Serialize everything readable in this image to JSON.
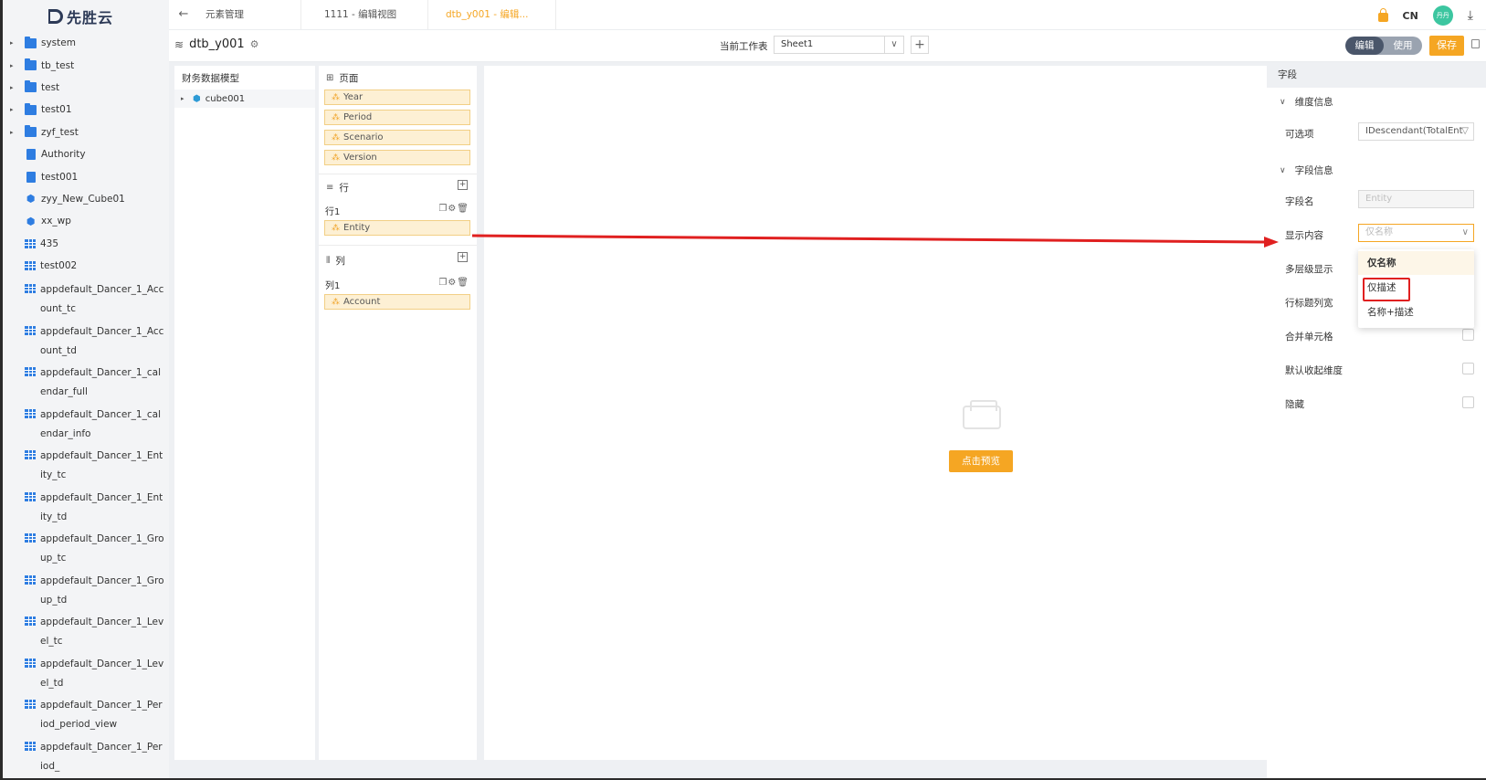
{
  "app": {
    "logo_text": "先胜云"
  },
  "sidebar": {
    "items": [
      {
        "label": "system",
        "type": "folder",
        "expandable": true
      },
      {
        "label": "tb_test",
        "type": "folder",
        "expandable": true
      },
      {
        "label": "test",
        "type": "folder",
        "expandable": true
      },
      {
        "label": "test01",
        "type": "folder",
        "expandable": true
      },
      {
        "label": "zyf_test",
        "type": "folder",
        "expandable": true
      },
      {
        "label": "Authority",
        "type": "doc"
      },
      {
        "label": "test001",
        "type": "doc"
      },
      {
        "label": "zyy_New_Cube01",
        "type": "cube"
      },
      {
        "label": "xx_wp",
        "type": "cube"
      },
      {
        "label": "435",
        "type": "table"
      },
      {
        "label": "test002",
        "type": "table"
      },
      {
        "label": "appdefault_Dancer_1_Account_tc",
        "type": "table"
      },
      {
        "label": "appdefault_Dancer_1_Account_td",
        "type": "table"
      },
      {
        "label": "appdefault_Dancer_1_calendar_full",
        "type": "table"
      },
      {
        "label": "appdefault_Dancer_1_calendar_info",
        "type": "table"
      },
      {
        "label": "appdefault_Dancer_1_Entity_tc",
        "type": "table"
      },
      {
        "label": "appdefault_Dancer_1_Entity_td",
        "type": "table"
      },
      {
        "label": "appdefault_Dancer_1_Group_tc",
        "type": "table"
      },
      {
        "label": "appdefault_Dancer_1_Group_td",
        "type": "table"
      },
      {
        "label": "appdefault_Dancer_1_Level_tc",
        "type": "table"
      },
      {
        "label": "appdefault_Dancer_1_Level_td",
        "type": "table"
      },
      {
        "label": "appdefault_Dancer_1_Period_period_view",
        "type": "table"
      },
      {
        "label": "appdefault_Dancer_1_Period_",
        "type": "table"
      }
    ]
  },
  "topbar": {
    "tabs": [
      "元素管理",
      "1111 - 编辑视图",
      "dtb_y001 - 编辑..."
    ],
    "lang": "CN",
    "avatar_text": "丹丹"
  },
  "toolbar": {
    "doc_title": "dtb_y001",
    "worksheet_label": "当前工作表",
    "worksheet_value": "Sheet1",
    "mode_edit": "编辑",
    "mode_use": "使用",
    "save_label": "保存"
  },
  "model_panel": {
    "title": "财务数据模型",
    "cube": "cube001"
  },
  "dims_panel": {
    "page_title": "页面",
    "page_dims": [
      "Year",
      "Period",
      "Scenario",
      "Version"
    ],
    "row_title": "行",
    "row_label": "行1",
    "row_dims": [
      "Entity"
    ],
    "col_title": "列",
    "col_label": "列1",
    "col_dims": [
      "Account"
    ]
  },
  "canvas": {
    "preview_label": "点击预览"
  },
  "props": {
    "header": "字段",
    "dim_group": "维度信息",
    "optional_label": "可选项",
    "optional_value": "IDescendant(TotalEnt",
    "field_group": "字段信息",
    "field_name_label": "字段名",
    "field_name_value": "Entity",
    "display_label": "显示内容",
    "display_value": "仅名称",
    "multilevel_label": "多层级显示",
    "row_title_width_label": "行标题列宽",
    "merge_label": "合并单元格",
    "collapse_label": "默认收起维度",
    "hide_label": "隐藏",
    "dropdown_options": [
      "仅名称",
      "仅描述",
      "名称+描述"
    ]
  },
  "colors": {
    "accent": "#f5a623",
    "link_blue": "#2e7de1",
    "annotation_red": "#e02020"
  }
}
